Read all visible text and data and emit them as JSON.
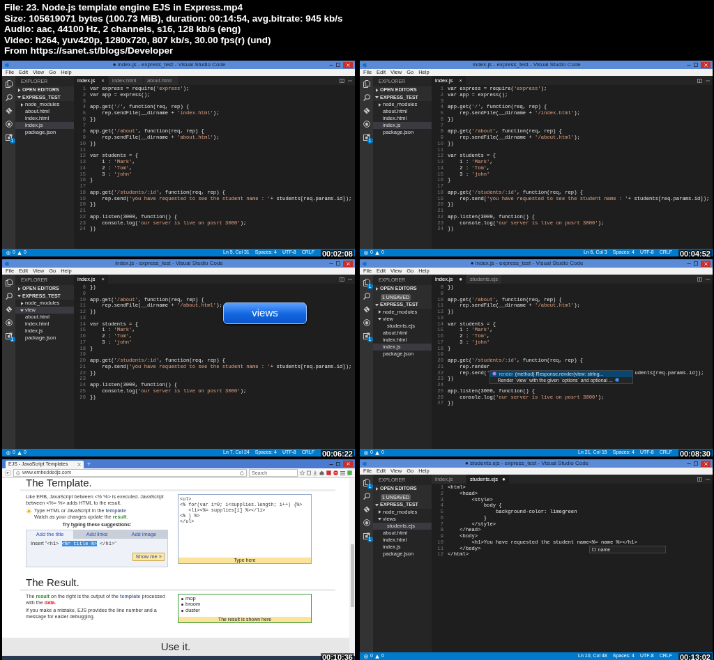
{
  "header": [
    "File: 23. Node.js template engine EJS in Express.mp4",
    "Size: 105619071 bytes (100.73 MiB), duration: 00:14:54, avg.bitrate: 945 kb/s",
    "Audio: aac, 44100 Hz, 2 channels, s16, 128 kb/s (eng)",
    "Video: h264, yuv420p, 1280x720, 807 kb/s, 30.00 fps(r) (und)",
    "From https://sanet.st/blogs/Developer"
  ],
  "frames": [
    {
      "kind": "vscode",
      "title": "● index.js - express_test - Visual Studio Code",
      "menu": [
        "File",
        "Edit",
        "View",
        "Go",
        "Help"
      ],
      "activity": [
        {
          "kind": "files"
        },
        {
          "kind": "search"
        },
        {
          "kind": "git"
        },
        {
          "kind": "debug"
        },
        {
          "kind": "extensions",
          "badge": "1"
        }
      ],
      "explorer": "EXPLORER",
      "sections": [
        {
          "label": "OPEN EDITORS",
          "expanded": false
        },
        {
          "label": "EXPRESS_TEST",
          "expanded": true
        }
      ],
      "tree": [
        {
          "label": "node_modules",
          "expanded": false,
          "selected": false
        },
        {
          "label": "about.html",
          "selected": false
        },
        {
          "label": "index.html",
          "selected": false
        },
        {
          "label": "index.js",
          "selected": true
        },
        {
          "label": "package.json",
          "selected": false
        }
      ],
      "tabs": [
        {
          "label": "index.js",
          "marker": "×",
          "selected": true
        },
        {
          "label": "index.html",
          "selected": false
        },
        {
          "label": "about.html",
          "selected": false
        }
      ],
      "lines": [
        {
          "number": "1",
          "code": "var express = require('express');"
        },
        {
          "number": "2",
          "code": "var app = express();"
        },
        {
          "number": "3"
        },
        {
          "number": "4",
          "code": "app.get('/', function(req, rep) {"
        },
        {
          "number": "5",
          "code": "    rep.sendFile(__dirname + 'index.html');"
        },
        {
          "number": "6",
          "code": "})"
        },
        {
          "number": "7"
        },
        {
          "number": "8",
          "code": "app.get('/about', function(req, rep) {"
        },
        {
          "number": "9",
          "code": "    rep.sendFile(__dirname + 'about.html');"
        },
        {
          "number": "10",
          "code": "})"
        },
        {
          "number": "11"
        },
        {
          "number": "12",
          "code": "var students = {"
        },
        {
          "number": "13",
          "code": "    1 : 'Mark',"
        },
        {
          "number": "14",
          "code": "    2 : 'Tom',"
        },
        {
          "number": "15",
          "code": "    3 : 'john'"
        },
        {
          "number": "16",
          "code": "}"
        },
        {
          "number": "17"
        },
        {
          "number": "18",
          "code": "app.get('/students/:id', function(req, rep) {"
        },
        {
          "number": "19",
          "code": "    rep.send('you have requested to see the student name : '+ students[req.params.id]);"
        },
        {
          "number": "20",
          "code": "})"
        },
        {
          "number": "21"
        },
        {
          "number": "22",
          "code": "app.listen(3000, function() {"
        },
        {
          "number": "23",
          "code": "    console.log('our server is live on posrt 3000');"
        },
        {
          "number": "24",
          "code": "})"
        }
      ],
      "status": {
        "errors": "0",
        "warnings": "0",
        "items": [
          "Ln 5, Col 31",
          "Spaces: 4",
          "UTF-8",
          "CRLF"
        ]
      },
      "timestamp": "00:02:08"
    },
    {
      "kind": "vscode",
      "title": "index.js - express_test - Visual Studio Code",
      "menu": [
        "File",
        "Edit",
        "View",
        "Go",
        "Help"
      ],
      "activity": [
        {
          "kind": "files"
        },
        {
          "kind": "search"
        },
        {
          "kind": "git"
        },
        {
          "kind": "debug"
        },
        {
          "kind": "extensions",
          "badge": "1"
        }
      ],
      "explorer": "EXPLORER",
      "sections": [
        {
          "label": "OPEN EDITORS",
          "expanded": false
        },
        {
          "label": "EXPRESS_TEST",
          "expanded": true
        }
      ],
      "tree": [
        {
          "label": "node_modules",
          "expanded": false,
          "selected": false
        },
        {
          "label": "about.html",
          "selected": false
        },
        {
          "label": "index.html",
          "selected": false
        },
        {
          "label": "index.js",
          "selected": true
        },
        {
          "label": "package.json",
          "selected": false
        }
      ],
      "tabs": [
        {
          "label": "index.js",
          "marker": "×",
          "selected": true
        }
      ],
      "lines": [
        {
          "number": "1",
          "code": "var express = require('express');"
        },
        {
          "number": "2",
          "code": "var app = express();"
        },
        {
          "number": "3"
        },
        {
          "number": "4",
          "code": "app.get('/', function(req, rep) {"
        },
        {
          "number": "5",
          "code": "    rep.sendFile(__dirname + '/index.html');"
        },
        {
          "number": "6",
          "code": "})"
        },
        {
          "number": "7"
        },
        {
          "number": "8",
          "code": "app.get('/about', function(req, rep) {"
        },
        {
          "number": "9",
          "code": "    rep.sendFile(__dirname + '/about.html');"
        },
        {
          "number": "10",
          "code": "})"
        },
        {
          "number": "11"
        },
        {
          "number": "12",
          "code": "var students = {"
        },
        {
          "number": "13",
          "code": "    1 : 'Mark',"
        },
        {
          "number": "14",
          "code": "    2 : 'Tom',"
        },
        {
          "number": "15",
          "code": "    3 : 'john'"
        },
        {
          "number": "16",
          "code": "}"
        },
        {
          "number": "17"
        },
        {
          "number": "18",
          "code": "app.get('/students/:id', function(req, rep) {"
        },
        {
          "number": "19",
          "code": "    rep.send('you have requested to see the student name : '+ students[req.params.id]);"
        },
        {
          "number": "20",
          "code": "})"
        },
        {
          "number": "21"
        },
        {
          "number": "22",
          "code": "app.listen(3000, function() {"
        },
        {
          "number": "23",
          "code": "    console.log('our server is live on posrt 3000');"
        },
        {
          "number": "24",
          "code": "})"
        }
      ],
      "status": {
        "errors": "0",
        "warnings": "0",
        "items": [
          "Ln 6, Col 3",
          "Spaces: 4",
          "UTF-8",
          "CRLF"
        ]
      },
      "timestamp": "00:04:52"
    },
    {
      "kind": "vscode",
      "title": "index.js - express_test - Visual Studio Code",
      "menu": [
        "File",
        "Edit",
        "View",
        "Go",
        "Help"
      ],
      "activity": [
        {
          "kind": "files"
        },
        {
          "kind": "search"
        },
        {
          "kind": "git"
        },
        {
          "kind": "debug"
        },
        {
          "kind": "extensions",
          "badge": "1"
        }
      ],
      "explorer": "EXPLORER",
      "sections": [
        {
          "label": "OPEN EDITORS",
          "expanded": false
        },
        {
          "label": "EXPRESS_TEST",
          "expanded": true
        }
      ],
      "tree": [
        {
          "label": "node_modules",
          "expanded": false,
          "selected": false
        },
        {
          "label": "view",
          "expanded": true,
          "selected": true
        },
        {
          "label": "about.html",
          "selected": false
        },
        {
          "label": "index.html",
          "selected": false
        },
        {
          "label": "index.js",
          "selected": false
        },
        {
          "label": "package.json",
          "selected": false
        }
      ],
      "tabs": [
        {
          "label": "index.js",
          "marker": "×",
          "selected": true
        }
      ],
      "lines": [
        {
          "number": "8",
          "code": "})"
        },
        {
          "number": "9"
        },
        {
          "number": "10",
          "code": "app.get('/about', function(req, rep) {"
        },
        {
          "number": "11",
          "code": "    rep.sendFile(__dirname + '/about.html');"
        },
        {
          "number": "12",
          "code": "})"
        },
        {
          "number": "13"
        },
        {
          "number": "14",
          "code": "var students = {"
        },
        {
          "number": "15",
          "code": "    1 : 'Mark',"
        },
        {
          "number": "16",
          "code": "    2 : 'Tom',"
        },
        {
          "number": "17",
          "code": "    3 : 'john'"
        },
        {
          "number": "18",
          "code": "}"
        },
        {
          "number": "19"
        },
        {
          "number": "20",
          "code": "app.get('/students/:id', function(req, rep) {"
        },
        {
          "number": "21",
          "code": "    rep.send('you have requested to see the student name : '+ students[req.params.id]);"
        },
        {
          "number": "22",
          "code": "})"
        },
        {
          "number": "23"
        },
        {
          "number": "24",
          "code": "app.listen(3000, function() {"
        },
        {
          "number": "25",
          "code": "    console.log('our server is live on posrt 3000');"
        },
        {
          "number": "26",
          "code": "})"
        }
      ],
      "callout": "views",
      "status": {
        "errors": "0",
        "warnings": "0",
        "items": [
          "Ln 7, Col 24",
          "Spaces: 4",
          "UTF-8",
          "CRLF"
        ]
      },
      "timestamp": "00:06:22"
    },
    {
      "kind": "vscode",
      "title": "● index.js - express_test - Visual Studio Code",
      "menu": [
        "File",
        "Edit",
        "View",
        "Go",
        "Help"
      ],
      "activity": [
        {
          "kind": "files",
          "badge": "1"
        },
        {
          "kind": "search"
        },
        {
          "kind": "git"
        },
        {
          "kind": "debug"
        },
        {
          "kind": "extensions",
          "badge": "1"
        }
      ],
      "explorer": "EXPLORER",
      "sections": [
        {
          "label": "OPEN EDITORS",
          "expanded": false,
          "badge": "1 UNSAVED"
        },
        {
          "label": "EXPRESS_TEST",
          "expanded": true
        }
      ],
      "tree": [
        {
          "label": "node_modules",
          "expanded": false,
          "selected": false
        },
        {
          "label": "view",
          "expanded": true,
          "selected": false,
          "children": [
            {
              "label": "students.ejs",
              "selected": false
            }
          ]
        },
        {
          "label": "about.html",
          "selected": false
        },
        {
          "label": "index.html",
          "selected": false
        },
        {
          "label": "index.js",
          "selected": true
        },
        {
          "label": "package.json",
          "selected": false
        }
      ],
      "tabs": [
        {
          "label": "index.js",
          "marker": "●",
          "selected": true
        },
        {
          "label": "students.ejs",
          "selected": false
        }
      ],
      "lines": [
        {
          "number": "8",
          "code": "})"
        },
        {
          "number": "9"
        },
        {
          "number": "10",
          "code": "app.get('/about', function(req, rep) {"
        },
        {
          "number": "11",
          "code": "    rep.sendFile(__dirname + '/about.html');"
        },
        {
          "number": "12",
          "code": "})"
        },
        {
          "number": "13"
        },
        {
          "number": "14",
          "code": "var students = {"
        },
        {
          "number": "15",
          "code": "    1 : 'Mark',"
        },
        {
          "number": "16",
          "code": "    2 : 'Tom',"
        },
        {
          "number": "17",
          "code": "    3 : 'john'"
        },
        {
          "number": "18",
          "code": "}"
        },
        {
          "number": "19"
        },
        {
          "number": "20",
          "code": "app.get('/students/:id', function(req, rep) {"
        },
        {
          "number": "21",
          "code": "    rep.render"
        },
        {
          "number": "22",
          "code": "    rep.send('",
          "suggest": {
            "label": "render",
            "detail": "(method) Response.render(view: string...",
            "doc": "Render `view` with the given `options` and optional ..."
          },
          "code_after": "udents[req.params.id]);"
        },
        {
          "number": "23",
          "code": "})"
        },
        {
          "number": "24"
        },
        {
          "number": "25",
          "code": "app.listen(3000, function() {"
        },
        {
          "number": "26",
          "code": "    console.log('our server is live on posrt 3000');"
        },
        {
          "number": "27",
          "code": "})"
        }
      ],
      "status": {
        "errors": "0",
        "warnings": "0",
        "items": [
          "Ln 21, Col 15",
          "Spaces: 4",
          "UTF-8",
          "CRLF"
        ]
      },
      "timestamp": "00:08:30"
    },
    {
      "kind": "browser",
      "tab_title": "EJS - JavaScript Templates",
      "new_tab": "+",
      "url": "www.embeddedjs.com",
      "search_placeholder": "Search",
      "template_heading": "The Template.",
      "intro": "Like ERB, JavaScript between <% %> is executed. JavaScript between <%= %> adds HTML to the result.",
      "tip": [
        [
          {
            "text": "Type HTML or JavaScript in the "
          },
          {
            "text": "template",
            "kind": "template"
          }
        ],
        [
          {
            "text": "Watch as your changes update the "
          },
          {
            "text": "result",
            "kind": "result"
          },
          {
            "text": "."
          }
        ]
      ],
      "suggestions_label": "Try typing these suggestions:",
      "suggestion_tabs": [
        {
          "label": "Add the title",
          "selected": true
        },
        {
          "label": "Add links",
          "selected": false
        },
        {
          "label": "Add image",
          "selected": false
        }
      ],
      "insert": [
        {
          "text": "Insert \""
        },
        {
          "text": "<h1> ",
          "kind": "code"
        },
        {
          "text": "<%= title %>",
          "kind": "selected"
        },
        {
          "text": " </h1>",
          "kind": "code"
        },
        {
          "text": "\""
        }
      ],
      "show_button": "Show me »",
      "template_code": [
        "<ul>",
        "<% for(var i=0; i<supplies.length; i++) {%>",
        "   <li><%= supplies[i] %></li>",
        "<% } %>",
        "</ul>"
      ],
      "template_footer": "Type here",
      "result_heading": "The Result.",
      "result_text": [
        {
          "text": "The "
        },
        {
          "text": "result",
          "kind": "result"
        },
        {
          "text": " on the right is the output of the "
        },
        {
          "text": "template",
          "kind": "template"
        },
        {
          "text": " processed with the "
        },
        {
          "text": "data",
          "kind": "data"
        },
        {
          "text": "."
        }
      ],
      "error_text": "If you make a mistake, EJS provides the line number and a message for easier debugging.",
      "result_items": [
        "mop",
        "broom",
        "duster"
      ],
      "result_footer": "The result is shown here",
      "use_heading": "Use it.",
      "timestamp": "00:10:36"
    },
    {
      "kind": "vscode",
      "title": "● students.ejs - express_test - Visual Studio Code",
      "menu": [
        "File",
        "Edit",
        "View",
        "Go",
        "Help"
      ],
      "activity": [
        {
          "kind": "files",
          "badge": "1"
        },
        {
          "kind": "search"
        },
        {
          "kind": "git"
        },
        {
          "kind": "debug"
        },
        {
          "kind": "extensions",
          "badge": "1"
        }
      ],
      "explorer": "EXPLORER",
      "sections": [
        {
          "label": "OPEN EDITORS",
          "expanded": false,
          "badge": "1 UNSAVED"
        },
        {
          "label": "EXPRESS_TEST",
          "expanded": true
        }
      ],
      "tree": [
        {
          "label": "node_modules",
          "expanded": false,
          "selected": false
        },
        {
          "label": "views",
          "expanded": true,
          "selected": false,
          "children": [
            {
              "label": "students.ejs",
              "selected": true
            }
          ]
        },
        {
          "label": "about.html",
          "selected": false
        },
        {
          "label": "index.html",
          "selected": false
        },
        {
          "label": "index.js",
          "selected": false
        },
        {
          "label": "package.json",
          "selected": false
        }
      ],
      "tabs": [
        {
          "label": "index.js",
          "selected": false
        },
        {
          "label": "students.ejs",
          "marker": "●",
          "selected": true
        }
      ],
      "lines": [
        {
          "number": "1",
          "code": "<html>"
        },
        {
          "number": "2",
          "code": "    <head>"
        },
        {
          "number": "3",
          "code": "        <style>"
        },
        {
          "number": "4",
          "code": "            body {"
        },
        {
          "number": "5",
          "code": "                background-color: limegreen"
        },
        {
          "number": "6",
          "code": "            }"
        },
        {
          "number": "7",
          "code": "        </style>"
        },
        {
          "number": "8",
          "code": "    </head>"
        },
        {
          "number": "9",
          "code": "    <body>"
        },
        {
          "number": "10",
          "code": "        <h1>You have requested the student name",
          "suggest": {
            "label": "name"
          },
          "code_after": "<%= name %></h1>"
        },
        {
          "number": "11",
          "code": "    </body>"
        },
        {
          "number": "12",
          "code": "</html>"
        }
      ],
      "status": {
        "errors": "0",
        "warnings": "0",
        "items": [
          "Ln 10, Col 48",
          "Spaces: 4",
          "UTF-8",
          "CRLF"
        ]
      },
      "timestamp": "00:13:02"
    }
  ]
}
